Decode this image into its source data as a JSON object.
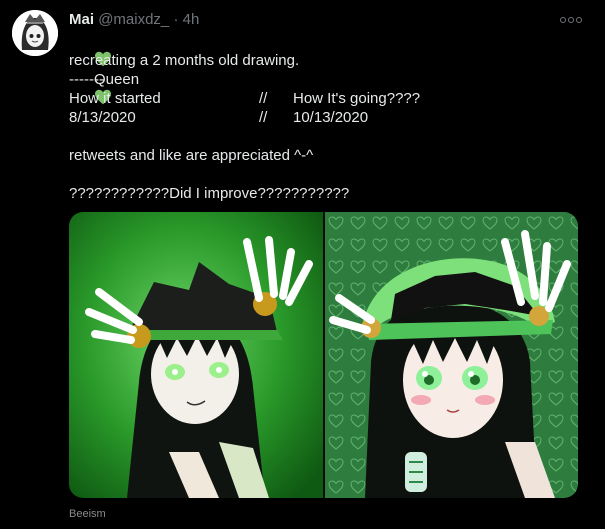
{
  "user": {
    "name": "Mai",
    "handle": "@maixdz_",
    "separator": "·",
    "time": "4h"
  },
  "tweet": {
    "title_line": "Queen",
    "line1": "recreating a 2 months old drawing.",
    "divider_line": "-------",
    "col_left_1": "How it started",
    "col_sep_1": "//",
    "col_right_1": "How It's going????",
    "col_left_2": "8/13/2020",
    "col_sep_2": "//",
    "col_right_2": "10/13/2020",
    "line_appreciated": "retweets and like are appreciated ^-^",
    "line_question": "????????????Did I improve???????????"
  },
  "media": {
    "watermark": "Beeism"
  },
  "colors": {
    "heart": "#7cc36a",
    "left_bg": "#2a9a2a",
    "right_bg": "#2e7d3e"
  },
  "icons": {
    "more": "more-horizontal-icon",
    "heart": "green-heart-icon"
  }
}
